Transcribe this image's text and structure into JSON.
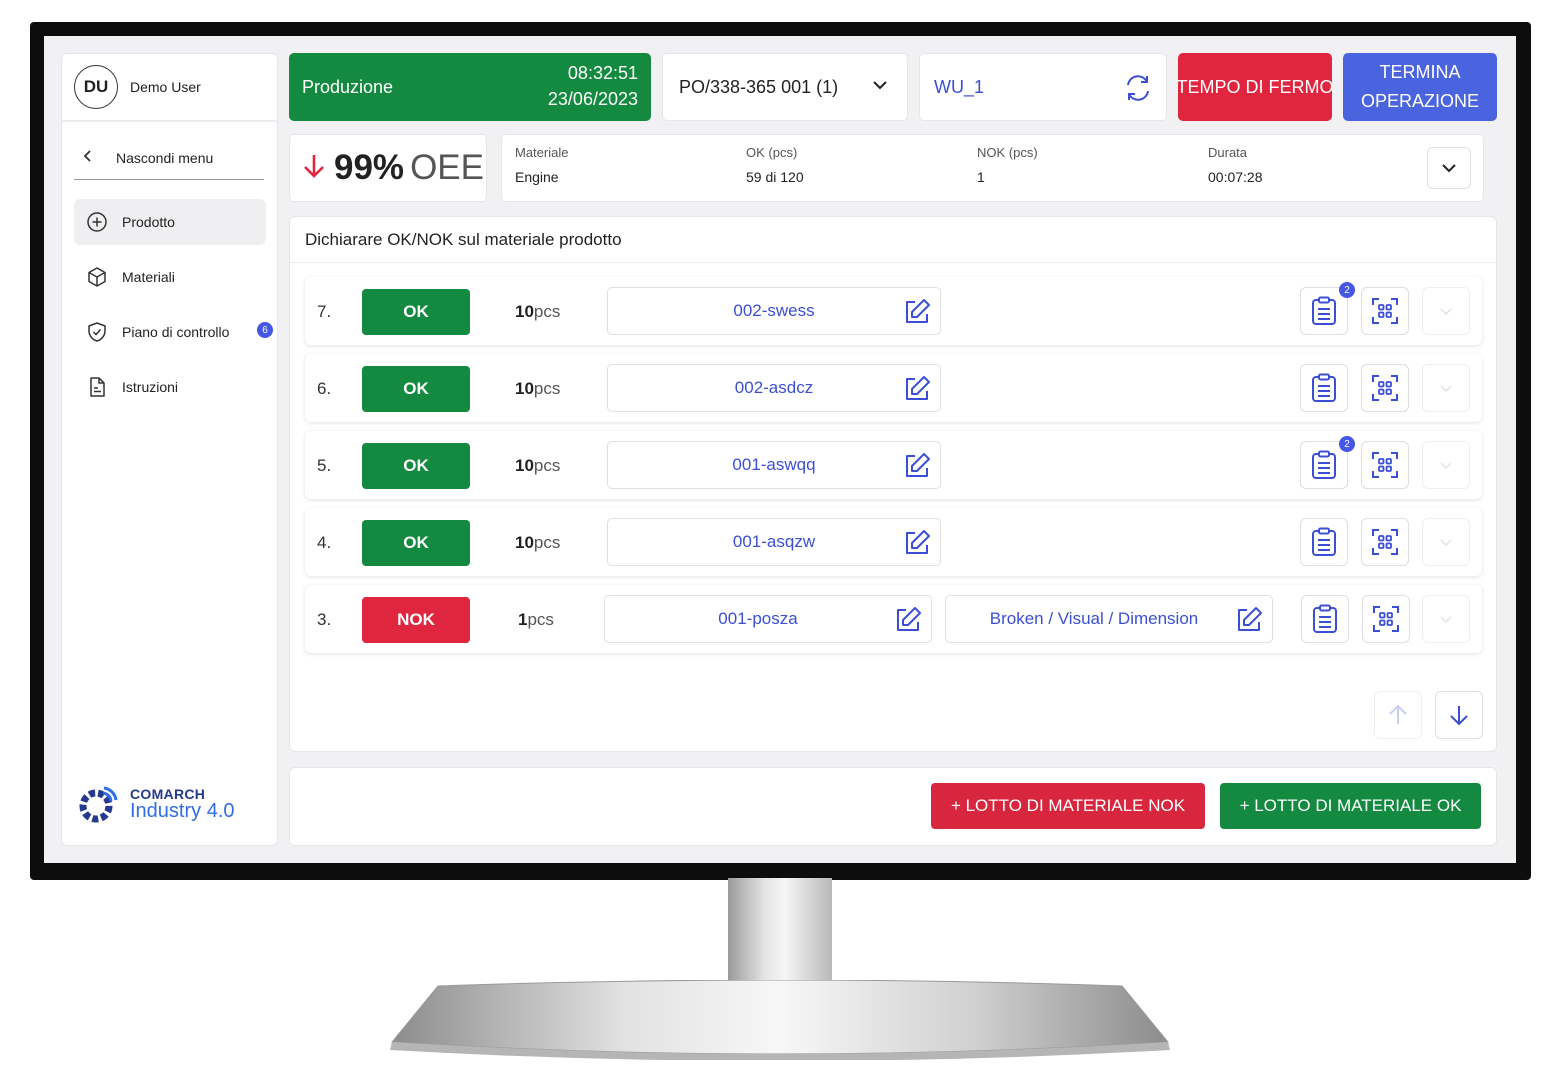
{
  "user": {
    "initials": "DU",
    "name": "Demo User"
  },
  "sidebar": {
    "hide_menu": "Nascondi menu",
    "items": [
      {
        "label": "Prodotto",
        "icon": "plus-circle-icon",
        "active": true
      },
      {
        "label": "Materiali",
        "icon": "cube-icon"
      },
      {
        "label": "Piano di controllo",
        "icon": "shield-check-icon",
        "badge": "6"
      },
      {
        "label": "Istruzioni",
        "icon": "document-icon"
      }
    ],
    "brand": {
      "line1": "COMARCH",
      "line2": "Industry 4.0"
    }
  },
  "header": {
    "status_label": "Produzione",
    "time": "08:32:51",
    "date": "23/06/2023",
    "order": "PO/338-365 001 (1)",
    "work_unit": "WU_1",
    "downtime_button": "TEMPO DI FERMO",
    "finish_button_line1": "TERMINA",
    "finish_button_line2": "OPERAZIONE"
  },
  "oee": {
    "value": "99%",
    "label": "OEE",
    "trend": "down"
  },
  "info": {
    "material_label": "Materiale",
    "material_value": "Engine",
    "ok_label": "OK (pcs)",
    "ok_value": "59 di 120",
    "nok_label": "NOK (pcs)",
    "nok_value": "1",
    "duration_label": "Durata",
    "duration_value": "00:07:28"
  },
  "panel": {
    "title": "Dichiarare OK/NOK sul materiale prodotto",
    "rows": [
      {
        "index": "7.",
        "status": "OK",
        "qty": "10",
        "unit": "pcs",
        "lot": "002-swess",
        "badge": "2"
      },
      {
        "index": "6.",
        "status": "OK",
        "qty": "10",
        "unit": "pcs",
        "lot": "002-asdcz"
      },
      {
        "index": "5.",
        "status": "OK",
        "qty": "10",
        "unit": "pcs",
        "lot": "001-aswqq",
        "badge": "2"
      },
      {
        "index": "4.",
        "status": "OK",
        "qty": "10",
        "unit": "pcs",
        "lot": "001-asqzw"
      },
      {
        "index": "3.",
        "status": "NOK",
        "qty": "1",
        "unit": "pcs",
        "lot": "001-posza",
        "reason": "Broken / Visual / Dimension"
      }
    ]
  },
  "footer": {
    "nok_button": "+ LOTTO DI MATERIALE NOK",
    "ok_button": "+ LOTTO DI MATERIALE OK"
  },
  "colors": {
    "green": "#138a3f",
    "red": "#e0263f",
    "blue": "#4a63df",
    "link_blue": "#3b4fd6"
  }
}
